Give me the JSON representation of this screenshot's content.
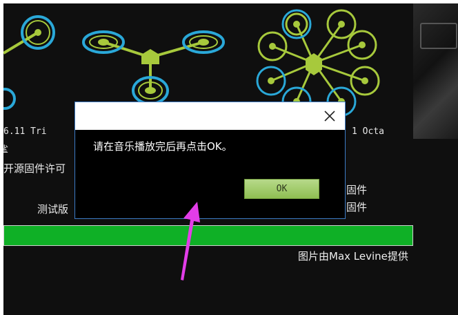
{
  "frames": [
    {
      "label": "6.11 Tri"
    },
    {
      "label": ""
    },
    {
      "label": "1 Octa"
    }
  ],
  "left_text": {
    "line1": "挲",
    "line2": "开源固件许可",
    "line3": "测试版"
  },
  "right_text": {
    "line1": "固件",
    "line2": "固件"
  },
  "progress": {
    "fraction": 1.0
  },
  "credit": "图片由Max Levine提供",
  "dialog": {
    "message": "请在音乐播放完后再点击OK。",
    "ok_label": "OK"
  },
  "colors": {
    "accent_green": "#0fb026",
    "frame_green": "#a7c93c",
    "prop_blue": "#2aa8d8",
    "arrow_magenta": "#e23de8"
  }
}
